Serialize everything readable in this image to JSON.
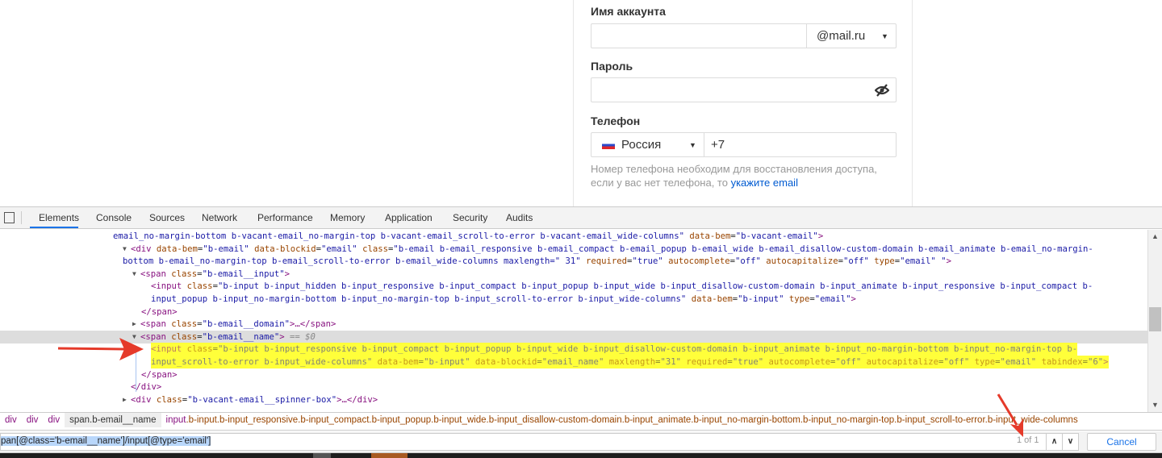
{
  "form": {
    "account_label": "Имя аккаунта",
    "account_value": "",
    "domain": "@mail.ru",
    "password_label": "Пароль",
    "password_value": "",
    "phone_label": "Телефон",
    "country": "Россия",
    "phone_prefix": "+7",
    "help_text": "Номер телефона необходим для восстановления доступа, если у вас нет телефона, то ",
    "help_link": "укажите email"
  },
  "devtools": {
    "tabs": [
      "Elements",
      "Console",
      "Sources",
      "Network",
      "Performance",
      "Memory",
      "Application",
      "Security",
      "Audits"
    ],
    "active_tab": "Elements",
    "lines": [
      [
        [
          "v",
          "email_no-margin-bottom b-vacant-email_no-margin-top b-vacant-email_scroll-to-error b-vacant-email_wide-columns\""
        ],
        [
          "a",
          " data-bem"
        ],
        [
          "p",
          "="
        ],
        [
          "v",
          "\"b-vacant-email\""
        ],
        [
          "t",
          ">"
        ]
      ],
      [
        [
          "t",
          "<div"
        ],
        [
          "a",
          " data-bem"
        ],
        [
          "p",
          "="
        ],
        [
          "v",
          "\"b-email\""
        ],
        [
          "a",
          " data-blockid"
        ],
        [
          "p",
          "="
        ],
        [
          "v",
          "\"email\""
        ],
        [
          "a",
          " class"
        ],
        [
          "p",
          "="
        ],
        [
          "v",
          "\"b-email b-email_responsive b-email_compact b-email_popup b-email_wide b-email_disallow-custom-domain b-email_animate b-email_no-margin-"
        ]
      ],
      [
        [
          "v",
          "bottom b-email_no-margin-top b-email_scroll-to-error b-email_wide-columns maxlength=\" 31\""
        ],
        [
          "a",
          " required"
        ],
        [
          "p",
          "="
        ],
        [
          "v",
          "\"true\""
        ],
        [
          "a",
          " autocomplete"
        ],
        [
          "p",
          "="
        ],
        [
          "v",
          "\"off\""
        ],
        [
          "a",
          " autocapitalize"
        ],
        [
          "p",
          "="
        ],
        [
          "v",
          "\"off\""
        ],
        [
          "a",
          " type"
        ],
        [
          "p",
          "="
        ],
        [
          "v",
          "\"email\" \""
        ],
        [
          "t",
          ">"
        ]
      ],
      [
        [
          "t",
          "<span"
        ],
        [
          "a",
          " class"
        ],
        [
          "p",
          "="
        ],
        [
          "v",
          "\"b-email__input\""
        ],
        [
          "t",
          ">"
        ]
      ],
      [
        [
          "t",
          "<input"
        ],
        [
          "a",
          " class"
        ],
        [
          "p",
          "="
        ],
        [
          "v",
          "\"b-input b-input_hidden b-input_responsive b-input_compact b-input_popup b-input_wide b-input_disallow-custom-domain b-input_animate b-input_responsive b-input_compact b-"
        ]
      ],
      [
        [
          "v",
          "input_popup b-input_no-margin-bottom b-input_no-margin-top b-input_scroll-to-error b-input_wide-columns\""
        ],
        [
          "a",
          " data-bem"
        ],
        [
          "p",
          "="
        ],
        [
          "v",
          "\"b-input\""
        ],
        [
          "a",
          " type"
        ],
        [
          "p",
          "="
        ],
        [
          "v",
          "\"email\""
        ],
        [
          "t",
          ">"
        ]
      ],
      [
        [
          "t",
          "</span>"
        ]
      ],
      [
        [
          "t",
          "<span"
        ],
        [
          "a",
          " class"
        ],
        [
          "p",
          "="
        ],
        [
          "v",
          "\"b-email__domain\""
        ],
        [
          "t",
          ">…</span>"
        ]
      ],
      [
        [
          "t",
          "<span"
        ],
        [
          "a",
          " class"
        ],
        [
          "p",
          "="
        ],
        [
          "v",
          "\"b-email__name\""
        ],
        [
          "t",
          ">"
        ],
        [
          "c",
          " == $0"
        ]
      ],
      [
        [
          "t",
          "<input"
        ],
        [
          "a",
          " class"
        ],
        [
          "p",
          "="
        ],
        [
          "v",
          "\"b-input b-input_responsive b-input_compact b-input_popup b-input_wide b-input_disallow-custom-domain b-input_animate b-input_no-margin-bottom b-input_no-margin-top b-"
        ]
      ],
      [
        [
          "v",
          "input_scroll-to-error b-input_wide-columns\""
        ],
        [
          "a",
          " data-bem"
        ],
        [
          "p",
          "="
        ],
        [
          "v",
          "\"b-input\""
        ],
        [
          "a",
          " data-blockid"
        ],
        [
          "p",
          "="
        ],
        [
          "v",
          "\"email_name\""
        ],
        [
          "a",
          " maxlength"
        ],
        [
          "p",
          "="
        ],
        [
          "v",
          "\"31\""
        ],
        [
          "a",
          " required"
        ],
        [
          "p",
          "="
        ],
        [
          "v",
          "\"true\""
        ],
        [
          "a",
          " autocomplete"
        ],
        [
          "p",
          "="
        ],
        [
          "v",
          "\"off\""
        ],
        [
          "a",
          " autocapitalize"
        ],
        [
          "p",
          "="
        ],
        [
          "v",
          "\"off\""
        ],
        [
          "a",
          " type"
        ],
        [
          "p",
          "="
        ],
        [
          "v",
          "\"email\""
        ],
        [
          "a",
          " tabindex"
        ],
        [
          "p",
          "="
        ],
        [
          "v",
          "\"6\""
        ],
        [
          "t",
          ">"
        ]
      ],
      [
        [
          "t",
          "</span>"
        ]
      ],
      [
        [
          "t",
          "</div>"
        ]
      ],
      [
        [
          "t",
          "<div"
        ],
        [
          "a",
          " class"
        ],
        [
          "p",
          "="
        ],
        [
          "v",
          "\"b-vacant-email__spinner-box\""
        ],
        [
          "t",
          ">…</div>"
        ]
      ]
    ],
    "breadcrumbs": [
      "div",
      "div",
      "div",
      "span.b-email__name"
    ],
    "breadcrumb_last_tag": "input",
    "breadcrumb_last_rest": ".b-input.b-input_responsive.b-input_compact.b-input_popup.b-input_wide.b-input_disallow-custom-domain.b-input_animate.b-input_no-margin-bottom.b-input_no-margin-top.b-input_scroll-to-error.b-input_wide-columns",
    "search_query": "pan[@class='b-email__name']/input[@type='email']",
    "match_count": "1 of 1",
    "cancel_label": "Cancel"
  },
  "colors": {
    "accent": "#1a73e8",
    "highlight": "#ffff3a",
    "annotation_arrow": "#e53a2a"
  }
}
